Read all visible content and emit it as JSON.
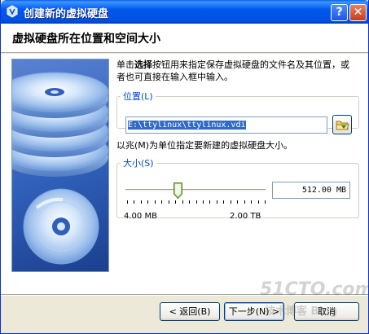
{
  "window": {
    "title": "创建新的虚拟硬盘",
    "help_label": "?",
    "close_label": "✕"
  },
  "header": {
    "title": "虚拟硬盘所在位置和空间大小"
  },
  "intro": {
    "prefix": "单击",
    "bold": "选择",
    "suffix": "按钮用来指定保存虚拟硬盘的文件名及其位置，或者也可直接在输入框中输入。"
  },
  "location": {
    "legend": "位置(L)",
    "value": "E:\\ttylinux\\ttylinux.vdi",
    "browse_icon": "folder-browse-icon"
  },
  "size": {
    "description": "以兆(M)为单位指定要新建的虚拟硬盘大小。",
    "legend": "大小(S)",
    "value": "512.00 MB",
    "min_label": "4.00 MB",
    "max_label": "2.00 TB",
    "slider_fraction": 0.37
  },
  "buttons": {
    "back": "< 返回(B)",
    "next": "下一步(N) >",
    "cancel": "取消"
  },
  "watermark": {
    "main": "51CTO.com",
    "sub": "技术博客 Blog"
  },
  "colors": {
    "titlebar": "#0058ee",
    "legend": "#0046d5",
    "selection": "#316ac5",
    "dialog_face": "#ece9d8"
  }
}
